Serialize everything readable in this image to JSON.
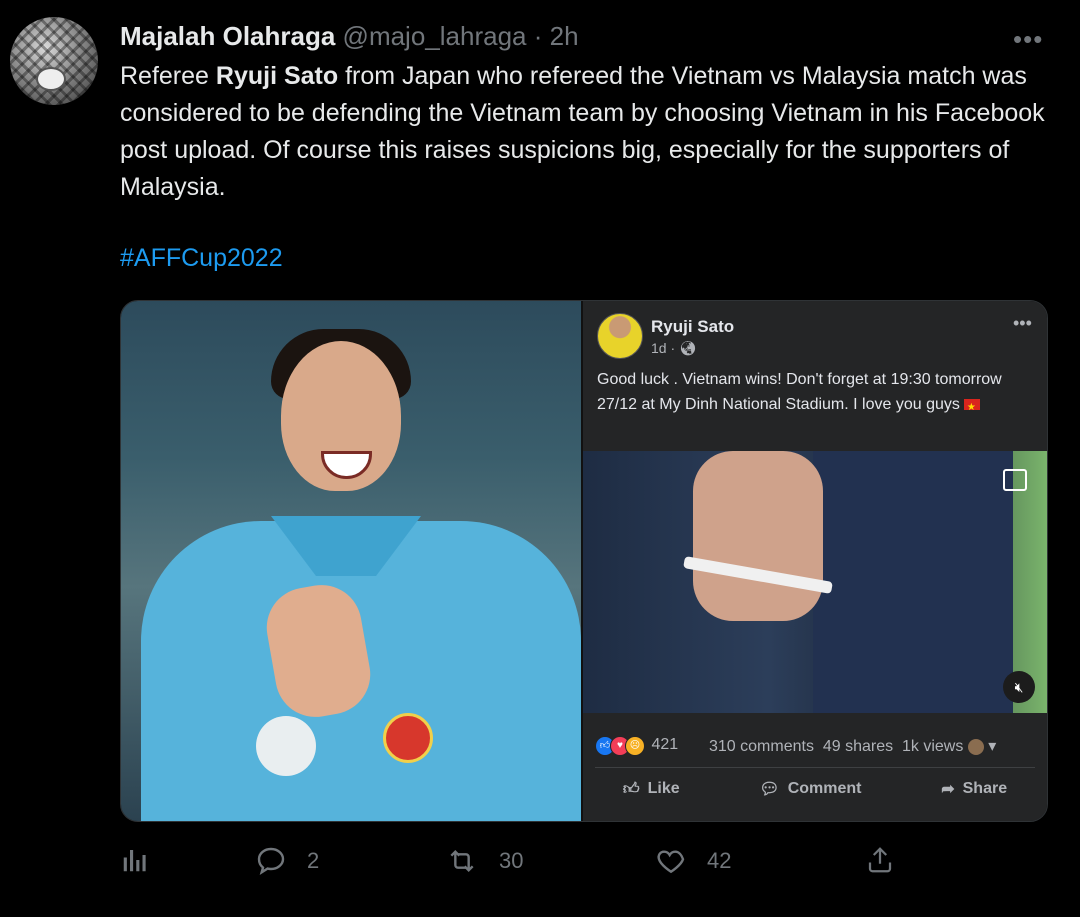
{
  "tweet": {
    "author_name": "Majalah Olahraga",
    "handle": "@majo_lahraga",
    "separator": "·",
    "time": "2h",
    "text_before": "Referee ",
    "text_bold": "Ryuji Sato",
    "text_after": " from Japan who refereed the Vietnam vs Malaysia match was considered to be defending the Vietnam team by choosing Vietnam in his Facebook post upload. Of course this raises suspicions big, especially for the supporters of Malaysia.",
    "hashtag": "#AFFCup2022",
    "more_icon": "•••"
  },
  "facebook_post": {
    "name": "Ryuji Sato",
    "meta": "1d ·",
    "more_icon": "•••",
    "text": "Good luck .  Vietnam wins!  Don't forget at 19:30 tomorrow 27/12 at My Dinh National Stadium.  I love you guys",
    "reaction_count": "421",
    "comments": "310 comments",
    "shares": "49 shares",
    "views": "1k views",
    "actions": {
      "like": "Like",
      "comment": "Comment",
      "share": "Share"
    }
  },
  "tweet_actions": {
    "replies": "2",
    "retweets": "30",
    "likes": "42"
  }
}
